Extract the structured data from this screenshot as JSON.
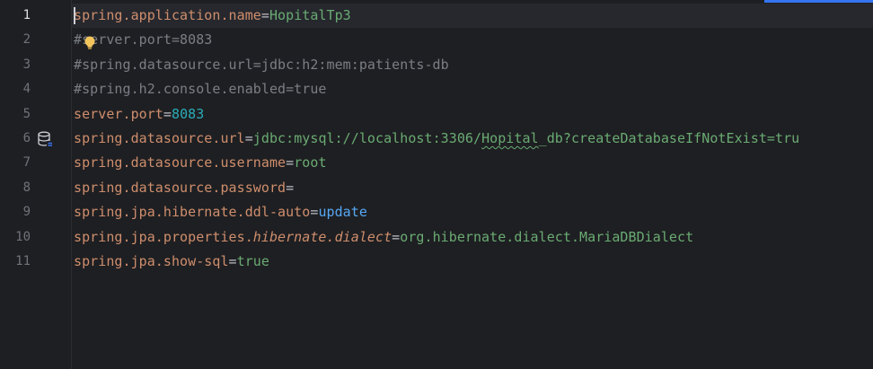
{
  "editor": {
    "lines": [
      {
        "number": "1",
        "parts": [
          {
            "t": "spring.application.name",
            "c": "key"
          },
          {
            "t": "=",
            "c": "eq"
          },
          {
            "t": "HopitalTp3",
            "c": "val"
          }
        ]
      },
      {
        "number": "2",
        "parts": [
          {
            "t": "#server.port=8083",
            "c": "comment"
          }
        ]
      },
      {
        "number": "3",
        "parts": [
          {
            "t": "#spring.datasource.url=jdbc:h2:mem:patients-db",
            "c": "comment"
          }
        ]
      },
      {
        "number": "4",
        "parts": [
          {
            "t": "#spring.h2.console.enabled=true",
            "c": "comment"
          }
        ]
      },
      {
        "number": "5",
        "parts": [
          {
            "t": "server.port",
            "c": "key"
          },
          {
            "t": "=",
            "c": "eq"
          },
          {
            "t": "8083",
            "c": "num"
          }
        ]
      },
      {
        "number": "6",
        "parts": [
          {
            "t": "spring.datasource.url",
            "c": "key"
          },
          {
            "t": "=",
            "c": "eq"
          },
          {
            "t": "jdbc:mysql://localhost:3306/",
            "c": "val"
          },
          {
            "t": "Hopital",
            "c": "val typo"
          },
          {
            "t": "_db?createDatabaseIfNotExist=tru",
            "c": "val"
          }
        ]
      },
      {
        "number": "7",
        "parts": [
          {
            "t": "spring.datasource.username",
            "c": "key"
          },
          {
            "t": "=",
            "c": "eq"
          },
          {
            "t": "root",
            "c": "val"
          }
        ]
      },
      {
        "number": "8",
        "parts": [
          {
            "t": "spring.datasource.password",
            "c": "key"
          },
          {
            "t": "=",
            "c": "eq"
          }
        ]
      },
      {
        "number": "9",
        "parts": [
          {
            "t": "spring.jpa.hibernate.ddl-auto",
            "c": "key"
          },
          {
            "t": "=",
            "c": "eq"
          },
          {
            "t": "update",
            "c": "kw"
          }
        ]
      },
      {
        "number": "10",
        "parts": [
          {
            "t": "spring.jpa.properties.",
            "c": "key"
          },
          {
            "t": "hibernate.dialect",
            "c": "key italic"
          },
          {
            "t": "=",
            "c": "eq"
          },
          {
            "t": "org.hibernate.dialect.MariaDBDialect",
            "c": "val"
          }
        ]
      },
      {
        "number": "11",
        "parts": [
          {
            "t": "spring.jpa.show-sql",
            "c": "key"
          },
          {
            "t": "=",
            "c": "eq"
          },
          {
            "t": "true",
            "c": "val"
          }
        ]
      }
    ],
    "icons": {
      "intention": "lightbulb-icon",
      "gutter_line_6": "database-icon"
    },
    "colors": {
      "background": "#1e1f22",
      "key": "#cf8e6d",
      "value": "#6aab73",
      "number": "#2aacb8",
      "keyword": "#56a8f5",
      "comment": "#7a7e85"
    }
  }
}
